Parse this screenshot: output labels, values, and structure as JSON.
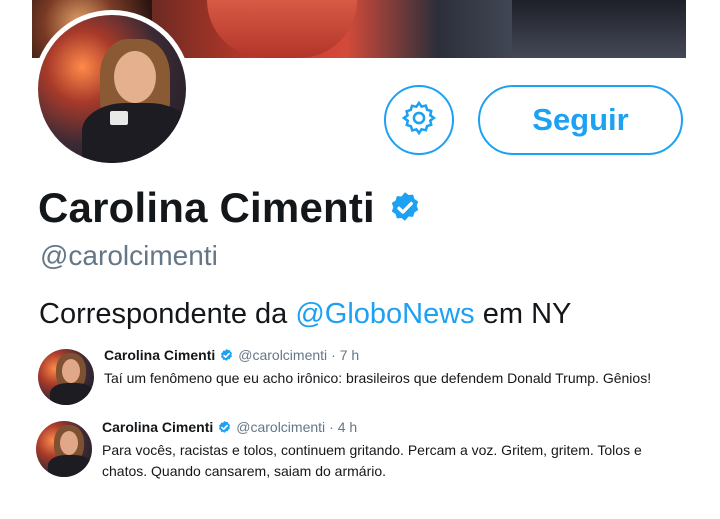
{
  "profile": {
    "name": "Carolina Cimenti",
    "handle": "@carolcimenti",
    "bio_prefix": "Correspondente da ",
    "bio_mention": "@GloboNews",
    "bio_suffix": " em NY",
    "follow_label": "Seguir",
    "verified": true
  },
  "tweets": [
    {
      "name": "Carolina Cimenti",
      "handle": "@carolcimenti",
      "time": "· 7 h",
      "text": "Taí um fenômeno que eu acho irônico: brasileiros que defendem Donald Trump. Gênios!"
    },
    {
      "name": "Carolina Cimenti",
      "handle": "@carolcimenti",
      "time": "· 4 h",
      "text": "Para vocês, racistas e tolos, continuem gritando. Percam a voz. Gritem, gritem. Tolos e chatos. Quando cansarem, saiam do armário."
    }
  ],
  "colors": {
    "accent": "#1da1f2",
    "text": "#14171a",
    "muted": "#657786"
  },
  "icons": {
    "settings": "gear-icon",
    "verified": "verified-badge-icon"
  }
}
